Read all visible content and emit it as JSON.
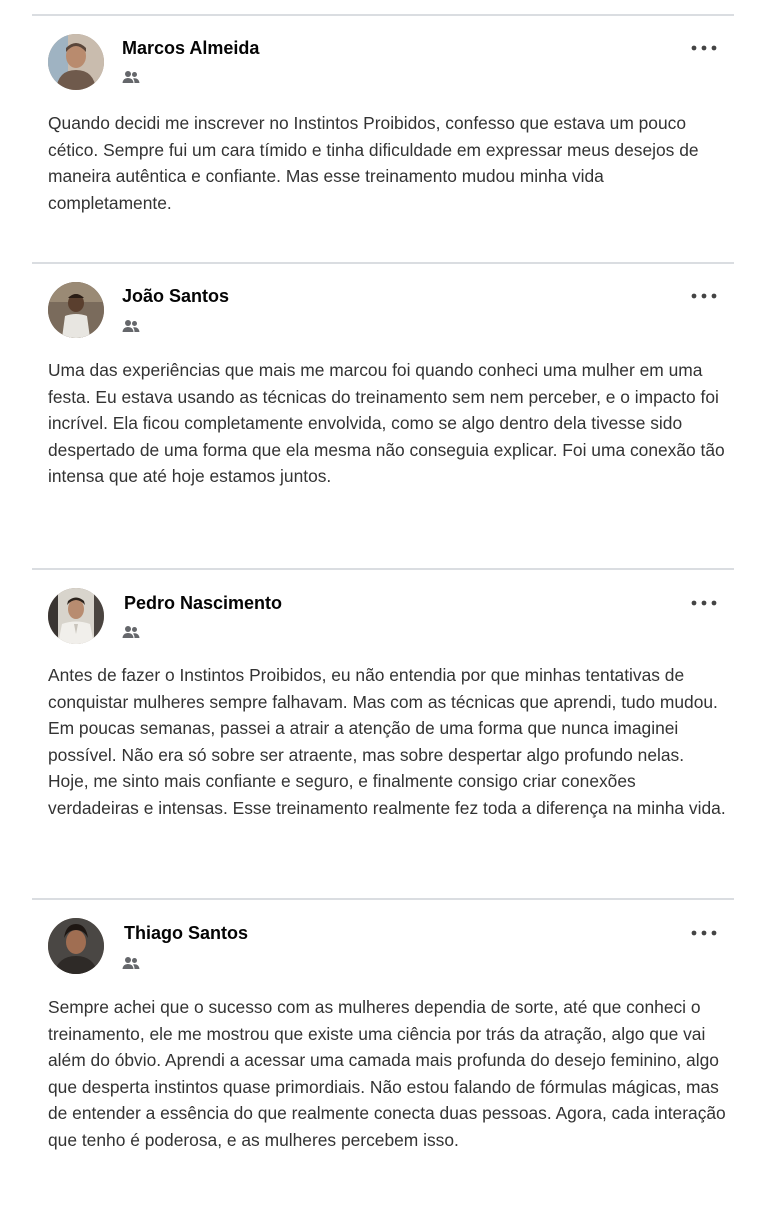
{
  "posts": [
    {
      "author": "Marcos Almeida",
      "audience_icon": "friends-icon",
      "more_icon": "more-options-icon",
      "text": "Quando decidi me inscrever no Instintos Proibidos, confesso que estava um pouco cético. Sempre fui um cara tímido e tinha dificuldade em expressar meus desejos de maneira autêntica e confiante. Mas esse treinamento mudou minha vida completamente."
    },
    {
      "author": "João Santos",
      "audience_icon": "friends-icon",
      "more_icon": "more-options-icon",
      "text": "Uma das experiências que mais me marcou foi quando conheci uma mulher em uma festa. Eu estava usando as técnicas do treinamento sem nem perceber, e o impacto foi incrível. Ela ficou completamente envolvida, como se algo dentro dela tivesse sido despertado de uma forma que ela mesma não conseguia explicar. Foi uma conexão tão intensa que até hoje estamos juntos."
    },
    {
      "author": "Pedro Nascimento",
      "audience_icon": "friends-icon",
      "more_icon": "more-options-icon",
      "text": "Antes de fazer o Instintos Proibidos, eu não entendia por que minhas tentativas de conquistar mulheres sempre falhavam. Mas com as técnicas que aprendi, tudo mudou. Em poucas semanas, passei a atrair a atenção de uma forma que nunca imaginei possível. Não era só sobre ser atraente, mas sobre despertar algo profundo nelas. Hoje, me sinto mais confiante e seguro, e finalmente consigo criar conexões verdadeiras e intensas. Esse treinamento realmente fez toda a diferença na minha vida."
    },
    {
      "author": "Thiago Santos",
      "audience_icon": "friends-icon",
      "more_icon": "more-options-icon",
      "text": "Sempre achei que o sucesso com as mulheres dependia de sorte, até que conheci o treinamento, ele me mostrou que existe uma ciência por trás da atração, algo que vai além do óbvio. Aprendi a acessar uma camada mais profunda do desejo feminino, algo que desperta instintos quase primordiais. Não estou falando de fórmulas mágicas, mas de entender a essência do que realmente conecta duas pessoas. Agora, cada interação que tenho é poderosa, e as mulheres percebem isso."
    }
  ]
}
